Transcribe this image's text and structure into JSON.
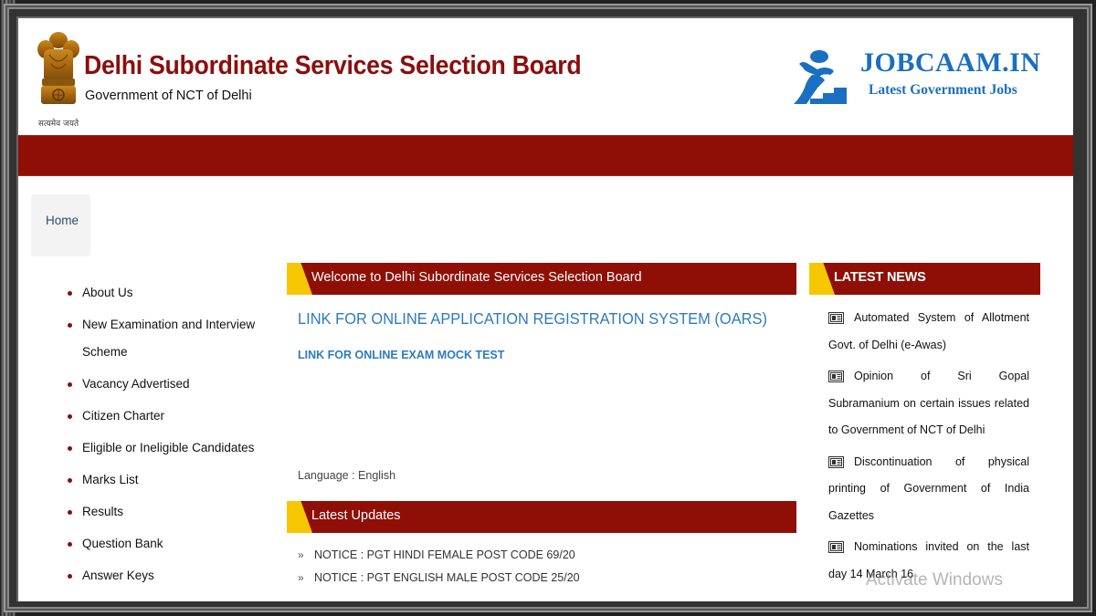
{
  "header": {
    "title": "Delhi Subordinate Services Selection Board",
    "subtitle": "Government of NCT of Delhi",
    "emblem_motto": "सत्यमेव जयते"
  },
  "brand": {
    "name": "JOBCAAM.IN",
    "tagline": "Latest Government Jobs",
    "color": "#1a6fc1"
  },
  "colors": {
    "primary_red": "#8f0f06",
    "accent_yellow": "#f6c700",
    "link_blue": "#2c7bbf"
  },
  "nav": {
    "home_label": "Home",
    "items": [
      {
        "label": "About Us"
      },
      {
        "label": "New Examination and Interview Scheme"
      },
      {
        "label": "Vacancy Advertised"
      },
      {
        "label": "Citizen Charter"
      },
      {
        "label": "Eligible or Ineligible Candidates"
      },
      {
        "label": "Marks List"
      },
      {
        "label": "Results"
      },
      {
        "label": "Question Bank"
      },
      {
        "label": "Answer Keys"
      }
    ]
  },
  "main": {
    "welcome_heading": "Welcome to Delhi Subordinate Services Selection Board",
    "oars_link": "LINK FOR ONLINE APPLICATION REGISTRATION SYSTEM (OARS)",
    "mock_test_link": "LINK FOR ONLINE EXAM MOCK TEST",
    "language_label": "Language : English",
    "updates_heading": "Latest Updates",
    "updates": [
      {
        "bullet": "»",
        "text": "NOTICE : PGT HINDI FEMALE POST CODE 69/20"
      },
      {
        "bullet": "»",
        "text": "NOTICE : PGT ENGLISH MALE POST CODE 25/20"
      }
    ]
  },
  "news": {
    "heading": "LATEST NEWS",
    "icon": "newspaper-icon",
    "items": [
      {
        "text": "Automated System of Allotment Govt. of Delhi (e-Awas)"
      },
      {
        "text": "Opinion of Sri Gopal Subramanium on certain issues related to Government of NCT of Delhi"
      },
      {
        "text": "Discontinuation of physical printing of Government of India Gazettes"
      },
      {
        "text": "Nominations invited on the last day 14 March 16"
      }
    ]
  },
  "overlay": {
    "watermark": "Activate Windows"
  }
}
